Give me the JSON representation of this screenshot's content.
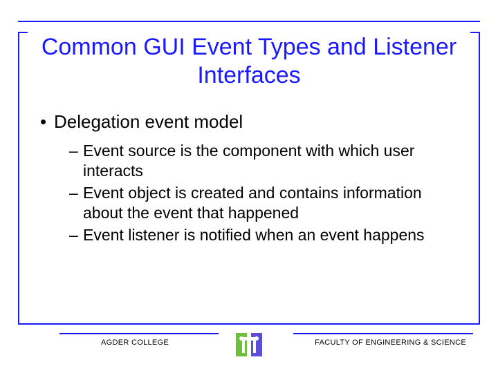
{
  "title": "Common GUI Event Types and Listener Interfaces",
  "bullets": {
    "lvl1": "Delegation event model",
    "lvl2": [
      "Event source is the component with which user interacts",
      "Event object is created and contains information about the event that happened",
      "Event listener is notified when an event happens"
    ]
  },
  "footer": {
    "left": "AGDER COLLEGE",
    "right": "FACULTY OF ENGINEERING & SCIENCE"
  }
}
